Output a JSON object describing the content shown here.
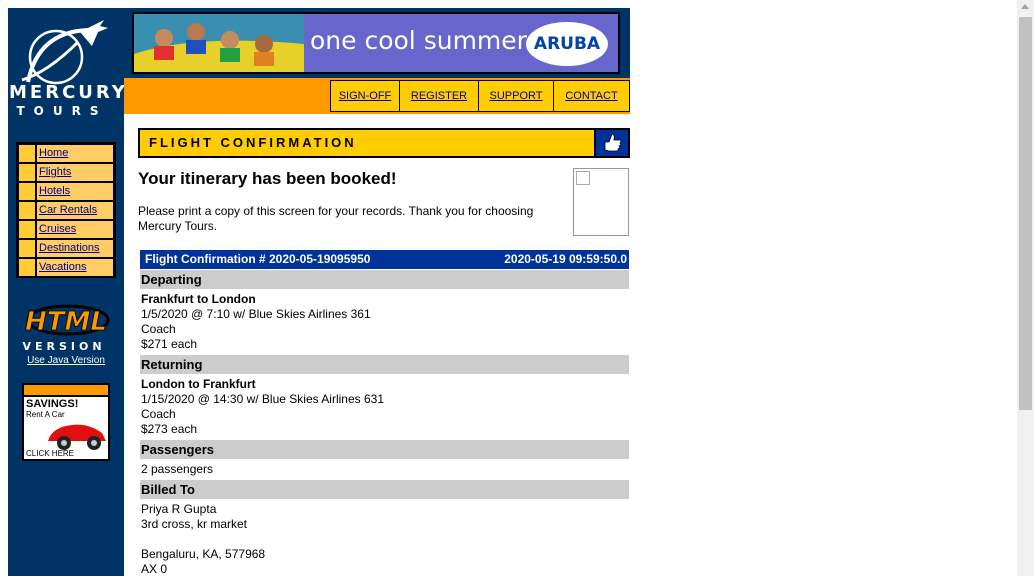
{
  "sidebar": {
    "logo_word1": "MERCURY",
    "logo_word2": "TOURS",
    "nav": [
      "Home",
      "Flights",
      "Hotels",
      "Car Rentals",
      "Cruises",
      "Destinations",
      "Vacations"
    ],
    "html_badge_line1": "HTML",
    "html_badge_line2": "VERSION",
    "java_link": "Use Java Version",
    "ad": {
      "title": "SAVINGS!",
      "subtitle": "Rent A Car",
      "cta": "CLICK HERE"
    }
  },
  "header": {
    "banner_text": "one cool summer",
    "banner_brand": "ARUBA",
    "toolbar": [
      "SIGN-OFF",
      "REGISTER",
      "SUPPORT",
      "CONTACT"
    ]
  },
  "main": {
    "title": "FLIGHT CONFIRMATION",
    "booked": "Your itinerary has been booked!",
    "note": "Please print a copy of this screen for your records. Thank you for choosing Mercury Tours.",
    "confirmation_label": "Flight Confirmation # 2020-05-19095950",
    "confirmation_time": "2020-05-19 09:59:50.0",
    "departing": {
      "header": "Departing",
      "route": "Frankfurt to London",
      "detail": "1/5/2020 @ 7:10 w/ Blue Skies Airlines 361",
      "class": "Coach",
      "price": "$271 each"
    },
    "returning": {
      "header": "Returning",
      "route": "London to Frankfurt",
      "detail": "1/15/2020 @ 14:30 w/ Blue Skies Airlines 631",
      "class": "Coach",
      "price": "$273 each"
    },
    "passengers": {
      "header": "Passengers",
      "value": "2 passengers"
    },
    "billed": {
      "header": "Billed To",
      "name": "Priya R Gupta",
      "street": "3rd cross, kr market",
      "city": "Bengaluru, KA, 577968",
      "card": "AX 0"
    }
  },
  "colors": {
    "navy": "#003366",
    "orange": "#FF9900",
    "yellow": "#FFCC00",
    "confirm_bar": "#003399",
    "section_gray": "#CCCCCC"
  }
}
